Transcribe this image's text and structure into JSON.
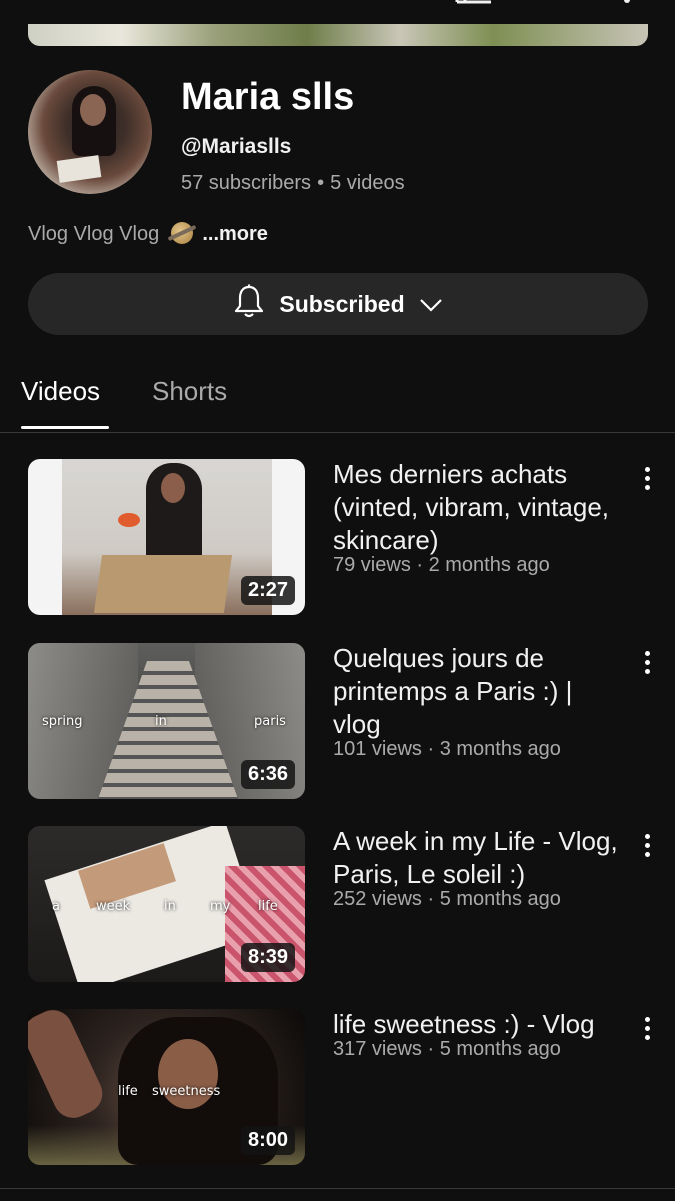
{
  "topbar": {
    "back_icon": "chevron-left-icon",
    "cast_icon": "cast-icon",
    "search_icon": "search-icon",
    "more_icon": "more-vertical-icon"
  },
  "channel": {
    "name": "Maria slls",
    "handle": "@Mariaslls",
    "subscribers": "57 subscribers",
    "separator": "•",
    "videos": "5 videos",
    "description": "Vlog Vlog Vlog",
    "more": "...more"
  },
  "subscribe": {
    "label": "Subscribed",
    "bell_icon": "bell-icon",
    "chevron_icon": "chevron-down-icon"
  },
  "tabs": [
    {
      "label": "Videos",
      "active": true
    },
    {
      "label": "Shorts",
      "active": false
    }
  ],
  "videos": [
    {
      "title": "Mes derniers achats (vinted, vibram, vintage, skincare)",
      "meta": "79 views · 2 months ago",
      "duration": "2:27",
      "overlay_words": []
    },
    {
      "title": "Quelques jours de printemps a Paris :) | vlog",
      "meta": "101 views · 3 months ago",
      "duration": "6:36",
      "overlay_words": [
        "spring",
        "in",
        "paris"
      ]
    },
    {
      "title": "A week in my Life - Vlog, Paris, Le soleil :)",
      "meta": "252 views · 5 months ago",
      "duration": "8:39",
      "overlay_words": [
        "a",
        "week",
        "in",
        "my",
        "life"
      ]
    },
    {
      "title": "life sweetness :) - Vlog",
      "meta": "317 views · 5 months ago",
      "duration": "8:00",
      "overlay_words": [
        "life",
        "sweetness"
      ]
    }
  ]
}
